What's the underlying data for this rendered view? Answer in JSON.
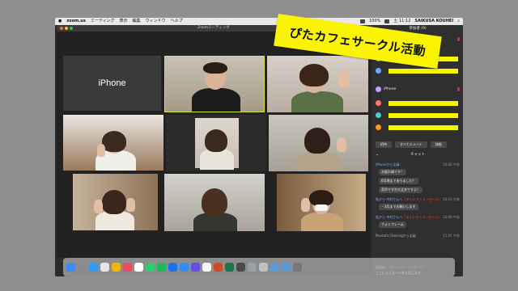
{
  "menubar": {
    "app": "zoom.us",
    "items": [
      "ミーティング",
      "表示",
      "編集",
      "ウィンドウ",
      "ヘルプ"
    ],
    "battery": "100%",
    "clock": "土 11:12",
    "user": "SAIKUSA KOUHEI"
  },
  "window": {
    "title": "Zoomミーティング"
  },
  "tiles": {
    "iphone_label": "iPhone"
  },
  "banner": {
    "text": "ぴたカフェサークル活動"
  },
  "participants_panel": {
    "title": "参加者 (9)",
    "rows": [
      {
        "avatar_color": "#ffffff",
        "name": ""
      },
      {
        "avatar_color": "#9ad0e0",
        "name": ""
      },
      {
        "avatar_color": "#c8a2ff",
        "name": "iPhone"
      },
      {
        "avatar_color": "#ff7a6a",
        "name": ""
      },
      {
        "avatar_color": "#4bd2c4",
        "name": ""
      },
      {
        "avatar_color": "#ff9a2a",
        "name": ""
      }
    ],
    "buttons": [
      "招待",
      "すべてミュート",
      "詳細"
    ]
  },
  "chat": {
    "title": "チャット",
    "messages": [
      {
        "from": "iPhoneから全員:",
        "time": "10:02 午前",
        "text": "お疲れ様です！",
        "dm": false
      },
      {
        "from": "",
        "time": "",
        "text": "6月頃までありました？",
        "dm": false
      },
      {
        "from": "",
        "time": "",
        "text": "音声ですか大丈夫ですよ！",
        "dm": false
      },
      {
        "from": "私から 中村さんへ",
        "dm_tag": "(ダイレクトメッセージ)",
        "time": "10:19 午前",
        "text": "・3月までお願いします",
        "dm": true
      },
      {
        "from": "私から 中村さんへ",
        "dm_tag": "(ダイレクトメッセージ)",
        "time": "10:49 午前",
        "text": "フォトフレーム",
        "dm": true
      },
      {
        "from": "Mustafa Cheeingから全員:",
        "time": "11:01 午前",
        "text": "",
        "dm": false
      }
    ],
    "to_label": "送信先：",
    "to_value": "(ダイレクトメッセージ)",
    "input_placeholder": "ここにメッセージを入力します..."
  }
}
